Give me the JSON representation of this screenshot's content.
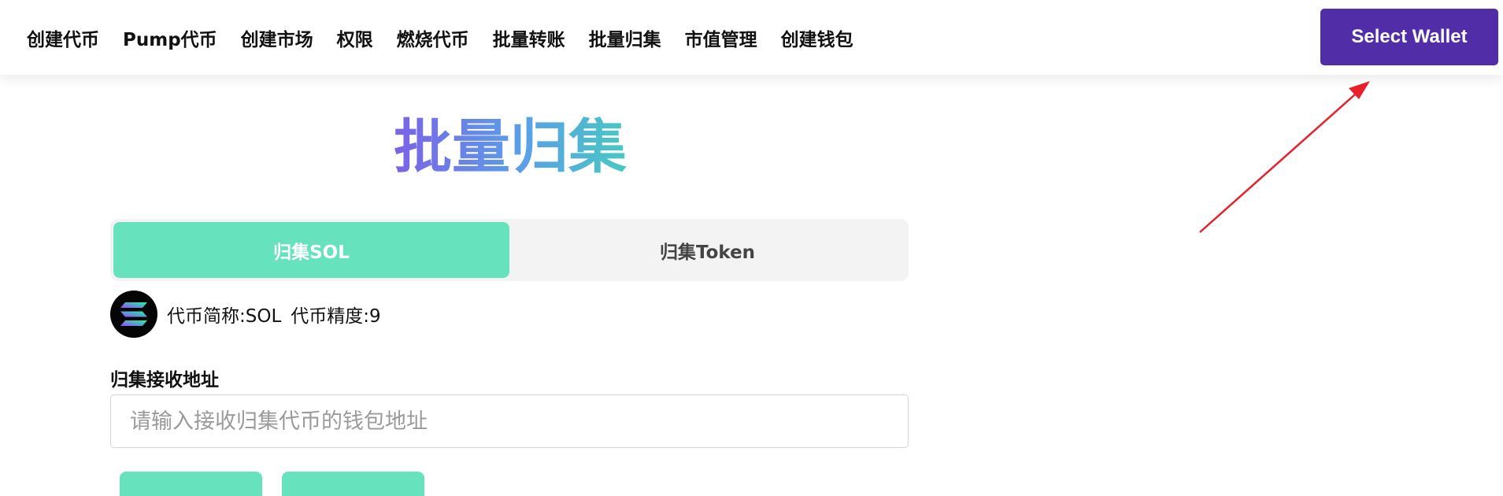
{
  "nav": {
    "items": [
      "创建代币",
      "Pump代币",
      "创建市场",
      "权限",
      "燃烧代币",
      "批量转账",
      "批量归集",
      "市值管理",
      "创建钱包"
    ],
    "wallet_button": "Select Wallet"
  },
  "page": {
    "title": "批量归集"
  },
  "tabs": {
    "items": [
      {
        "label": "归集SOL",
        "active": true
      },
      {
        "label": "归集Token",
        "active": false
      }
    ]
  },
  "token": {
    "icon": "solana-logo-icon",
    "symbol_text": "代币简称:SOL",
    "decimals_text": "代币精度:9"
  },
  "form": {
    "address_label": "归集接收地址",
    "address_placeholder": "请输入接收归集代币的钱包地址",
    "address_value": ""
  },
  "colors": {
    "accent_purple": "#512da8",
    "tab_active": "#66e3bd",
    "annotation_arrow": "#e8202a"
  }
}
